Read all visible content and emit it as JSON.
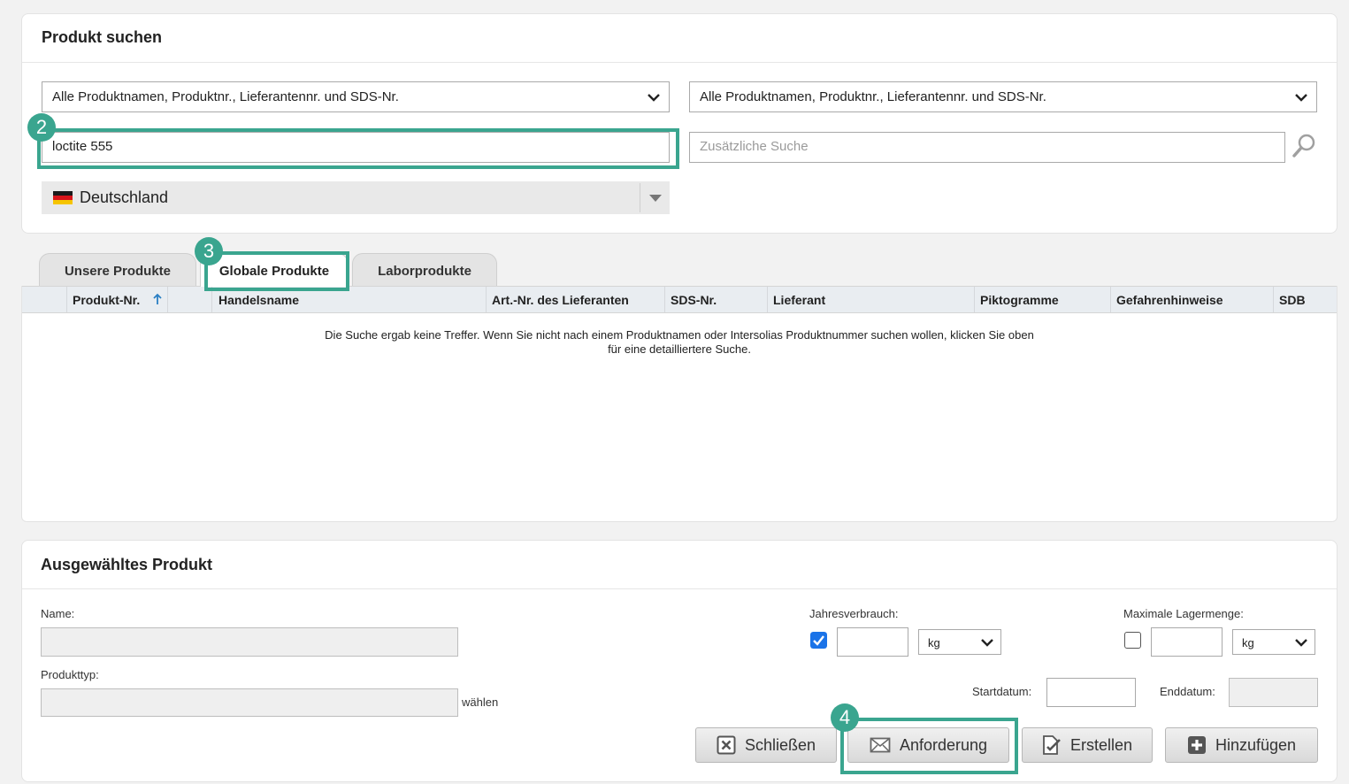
{
  "search_panel": {
    "title": "Produkt suchen",
    "scope_select_1": "Alle Produktnamen, Produktnr., Lieferantennr. und SDS-Nr.",
    "scope_select_2": "Alle Produktnamen, Produktnr., Lieferantennr. und SDS-Nr.",
    "search_value": "loctite 555",
    "additional_search_placeholder": "Zusätzliche Suche",
    "country": "Deutschland"
  },
  "tabs": [
    "Unsere Produkte",
    "Globale Produkte",
    "Laborprodukte"
  ],
  "active_tab": "Globale Produkte",
  "table": {
    "columns": [
      "Produkt-Nr.",
      "Handelsname",
      "Art.-Nr. des Lieferanten",
      "SDS-Nr.",
      "Lieferant",
      "Piktogramme",
      "Gefahrenhinweise",
      "SDB"
    ],
    "sort_column": "Produkt-Nr.",
    "sort_direction": "ascending",
    "empty_message_line1": "Die Suche ergab keine Treffer. Wenn Sie nicht nach einem Produktnamen oder Intersolias Produktnummer suchen wollen, klicken Sie oben",
    "empty_message_line2": "für eine detailliertere Suche."
  },
  "selected_panel": {
    "title": "Ausgewähltes Produkt",
    "name_label": "Name:",
    "type_label": "Produkttyp:",
    "choose_link": "wählen",
    "annual_label": "Jahresverbrauch:",
    "annual_checked": true,
    "annual_unit": "kg",
    "max_label": "Maximale Lagermenge:",
    "max_checked": false,
    "max_unit": "kg",
    "start_label": "Startdatum:",
    "end_label": "Enddatum:"
  },
  "buttons": {
    "close": "Schließen",
    "request": "Anforderung",
    "create": "Erstellen",
    "add": "Hinzufügen"
  },
  "step_badges": [
    "2",
    "3",
    "4"
  ],
  "colors": {
    "highlight": "#3aa58f",
    "sort_arrow": "#2a7fc4",
    "checkbox": "#1a73e8"
  }
}
